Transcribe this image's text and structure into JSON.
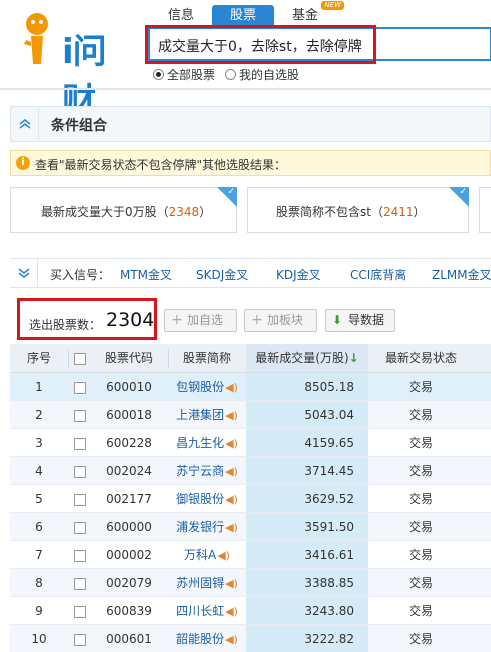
{
  "header": {
    "logo_text": "i问财",
    "tabs": [
      {
        "label": "信息"
      },
      {
        "label": "股票"
      },
      {
        "label": "基金",
        "badge": "NEW"
      }
    ],
    "search_value": "成交量大于0，去除st，去除停牌",
    "radios": [
      {
        "label": "全部股票"
      },
      {
        "label": "我的自选股"
      }
    ]
  },
  "conditions": {
    "title": "条件组合",
    "notice": "查看\"最新交易状态不包含停牌\"其他选股结果：",
    "cards": [
      {
        "label": "最新成交量大于0万股",
        "count": "2348"
      },
      {
        "label": "股票简称不包含st",
        "count": "2411"
      }
    ]
  },
  "signals": {
    "label": "买入信号：",
    "items": [
      "MTM金叉",
      "SKDJ金叉",
      "KDJ金叉",
      "CCI底背离",
      "ZLMM金叉"
    ]
  },
  "toolbar": {
    "count_label": "选出股票数：",
    "count": "2304",
    "btn_add_watch": "加自选",
    "btn_add_block": "加板块",
    "btn_export": "导数据"
  },
  "table": {
    "headers": {
      "idx": "序号",
      "code": "股票代码",
      "name": "股票简称",
      "vol": "最新成交量(万股)",
      "sort": "↓",
      "state": "最新交易状态"
    },
    "rows": [
      {
        "idx": "1",
        "code": "600010",
        "name": "包钢股份",
        "vol": "8505.18",
        "state": "交易"
      },
      {
        "idx": "2",
        "code": "600018",
        "name": "上港集团",
        "vol": "5043.04",
        "state": "交易"
      },
      {
        "idx": "3",
        "code": "600228",
        "name": "昌九生化",
        "vol": "4159.65",
        "state": "交易"
      },
      {
        "idx": "4",
        "code": "002024",
        "name": "苏宁云商",
        "vol": "3714.45",
        "state": "交易"
      },
      {
        "idx": "5",
        "code": "002177",
        "name": "御银股份",
        "vol": "3629.52",
        "state": "交易"
      },
      {
        "idx": "6",
        "code": "600000",
        "name": "浦发银行",
        "vol": "3591.50",
        "state": "交易"
      },
      {
        "idx": "7",
        "code": "000002",
        "name": "万科A",
        "vol": "3416.61",
        "state": "交易"
      },
      {
        "idx": "8",
        "code": "002079",
        "name": "苏州固锝",
        "vol": "3388.85",
        "state": "交易"
      },
      {
        "idx": "9",
        "code": "600839",
        "name": "四川长虹",
        "vol": "3243.80",
        "state": "交易"
      },
      {
        "idx": "10",
        "code": "000601",
        "name": "韶能股份",
        "vol": "3222.82",
        "state": "交易"
      }
    ]
  }
}
